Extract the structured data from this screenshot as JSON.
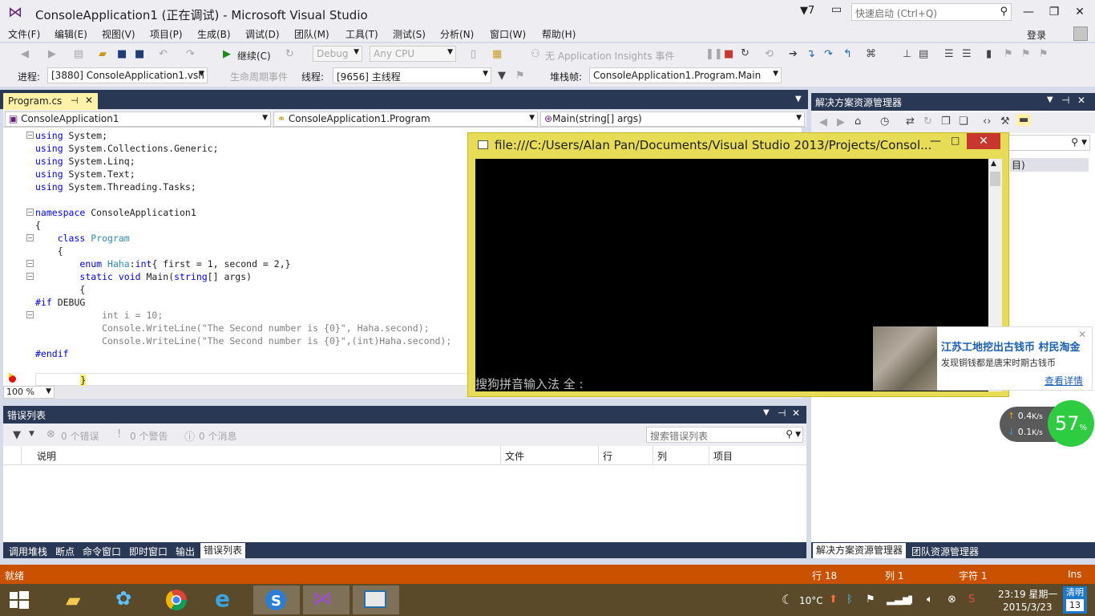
{
  "window": {
    "title": "ConsoleApplication1 (正在调试) - Microsoft Visual Studio",
    "notification_count": "7",
    "quick_launch_placeholder": "快速启动 (Ctrl+Q)",
    "login": "登录"
  },
  "menu": [
    "文件(F)",
    "编辑(E)",
    "视图(V)",
    "项目(P)",
    "生成(B)",
    "调试(D)",
    "团队(M)",
    "工具(T)",
    "测试(S)",
    "分析(N)",
    "窗口(W)",
    "帮助(H)"
  ],
  "toolbar": {
    "continue_label": "继续(C)",
    "config": "Debug",
    "platform": "Any CPU",
    "insights": "无 Application Insights 事件",
    "process_label": "进程:",
    "process_value": "[3880] ConsoleApplication1.vsh",
    "lifecycle_label": "生命周期事件",
    "thread_label": "线程:",
    "thread_value": "[9656] 主线程",
    "stackframe_label": "堆栈帧:",
    "stackframe_value": "ConsoleApplication1.Program.Main"
  },
  "editor": {
    "tab_name": "Program.cs",
    "nav_project": "ConsoleApplication1",
    "nav_class": "ConsoleApplication1.Program",
    "nav_member": "Main(string[] args)",
    "zoom": "100 %"
  },
  "console": {
    "title": "file:///C:/Users/Alan Pan/Documents/Visual Studio 2013/Projects/Consol...",
    "ime_text": "搜狗拼音输入法 全 :"
  },
  "solution_explorer": {
    "title": "解决方案资源管理器",
    "item": "目)",
    "tabs": [
      "解决方案资源管理器",
      "团队资源管理器"
    ]
  },
  "news": {
    "title": "江苏工地挖出古钱币 村民淘金",
    "subtitle": "发现铜钱都是唐宋时期古钱币",
    "more": "查看详情"
  },
  "speed": {
    "up": "0.4",
    "down": "0.1",
    "unit": "K/s",
    "percent": "57",
    "percent_sign": "%"
  },
  "error_list": {
    "title": "错误列表",
    "errors": "0 个错误",
    "warnings": "0 个警告",
    "messages": "0 个消息",
    "search_placeholder": "搜索错误列表",
    "columns": [
      "说明",
      "文件",
      "行",
      "列",
      "项目"
    ]
  },
  "bottom_tabs": [
    "调用堆栈",
    "断点",
    "命令窗口",
    "即时窗口",
    "输出",
    "错误列表"
  ],
  "status": {
    "ready": "就绪",
    "line": "行 18",
    "col": "列 1",
    "char": "字符 1",
    "ins": "Ins"
  },
  "taskbar": {
    "weather": "10°C",
    "time": "23:19 星期一",
    "date": "2015/3/23",
    "lang_top": "清明",
    "lang_bottom": "13"
  },
  "colors": {
    "accent": "#ca5100",
    "panel_header": "#293955",
    "tab_active": "#fff1a8",
    "console_frame": "#e6dc55"
  }
}
